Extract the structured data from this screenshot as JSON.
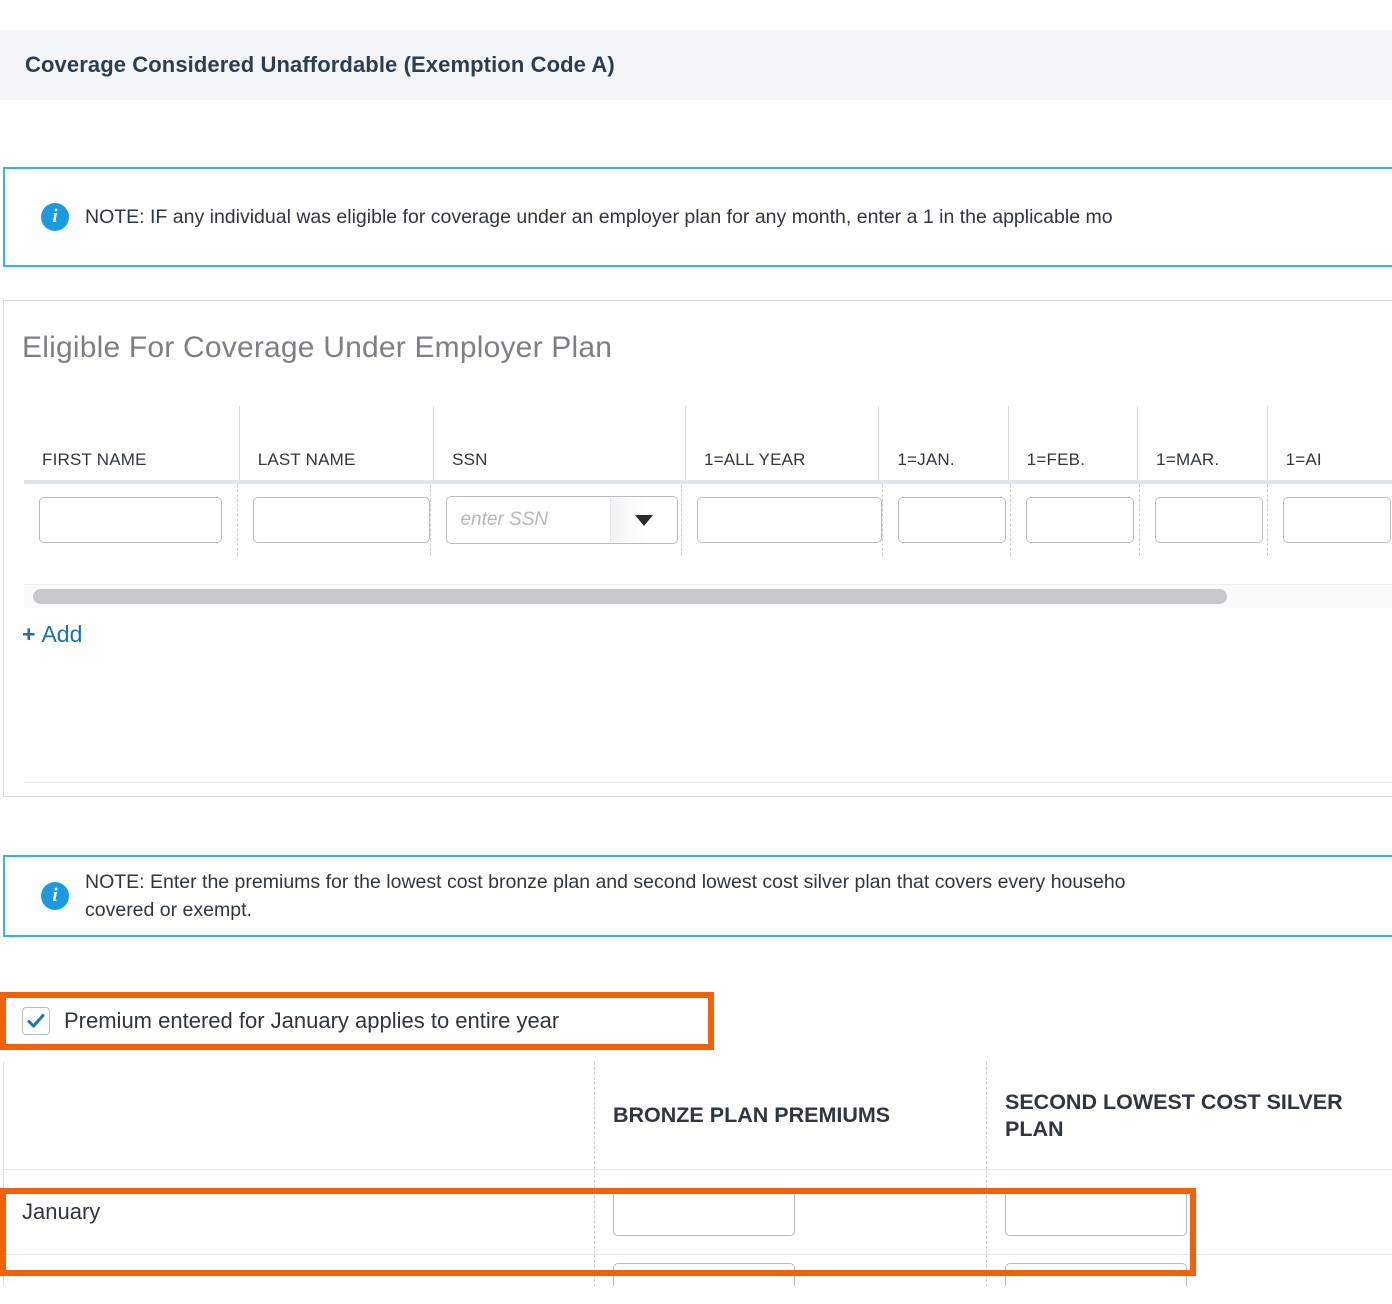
{
  "section": {
    "title": "Coverage Considered Unaffordable (Exemption Code A)"
  },
  "notes": [
    {
      "icon": "info-icon",
      "text": "NOTE: IF any individual was eligible for coverage under an employer plan for any month, enter a 1 in the applicable mo"
    },
    {
      "icon": "info-icon",
      "text": "NOTE: Enter the premiums for the lowest cost bronze plan and second lowest cost silver plan that covers every househo\ncovered or exempt."
    }
  ],
  "employer_plan": {
    "heading": "Eligible For Coverage Under Employer Plan",
    "columns": [
      "FIRST NAME",
      "LAST NAME",
      "SSN",
      "1=ALL YEAR",
      "1=JAN.",
      "1=FEB.",
      "1=MAR.",
      "1=AI"
    ],
    "row": {
      "first_name": "",
      "last_name": "",
      "ssn": "",
      "ssn_placeholder": "enter SSN",
      "all_year": "",
      "jan": "",
      "feb": "",
      "mar": "",
      "apr": ""
    },
    "add_label": "Add",
    "add_plus": "+",
    "scrollbar": "horizontal-scrollbar"
  },
  "premium_section": {
    "checkbox": {
      "label": "Premium entered for January applies to entire year",
      "checked": true,
      "highlight_color": "#ef6209"
    },
    "columns": [
      "",
      "BRONZE PLAN PREMIUMS",
      "SECOND LOWEST COST SILVER PLAN"
    ],
    "rows": [
      {
        "month": "January",
        "bronze": "",
        "silver": "",
        "highlighted": true
      },
      {
        "month": "",
        "bronze": "",
        "silver": "",
        "highlighted": false
      }
    ]
  },
  "colors": {
    "accent_blue": "#1a6fb5",
    "note_border": "#39b3ea",
    "info_badge": "#1b9ae0",
    "highlight_orange": "#ef6209",
    "header_bg": "#f4f5f8",
    "heading_gray": "#7b7f86"
  }
}
